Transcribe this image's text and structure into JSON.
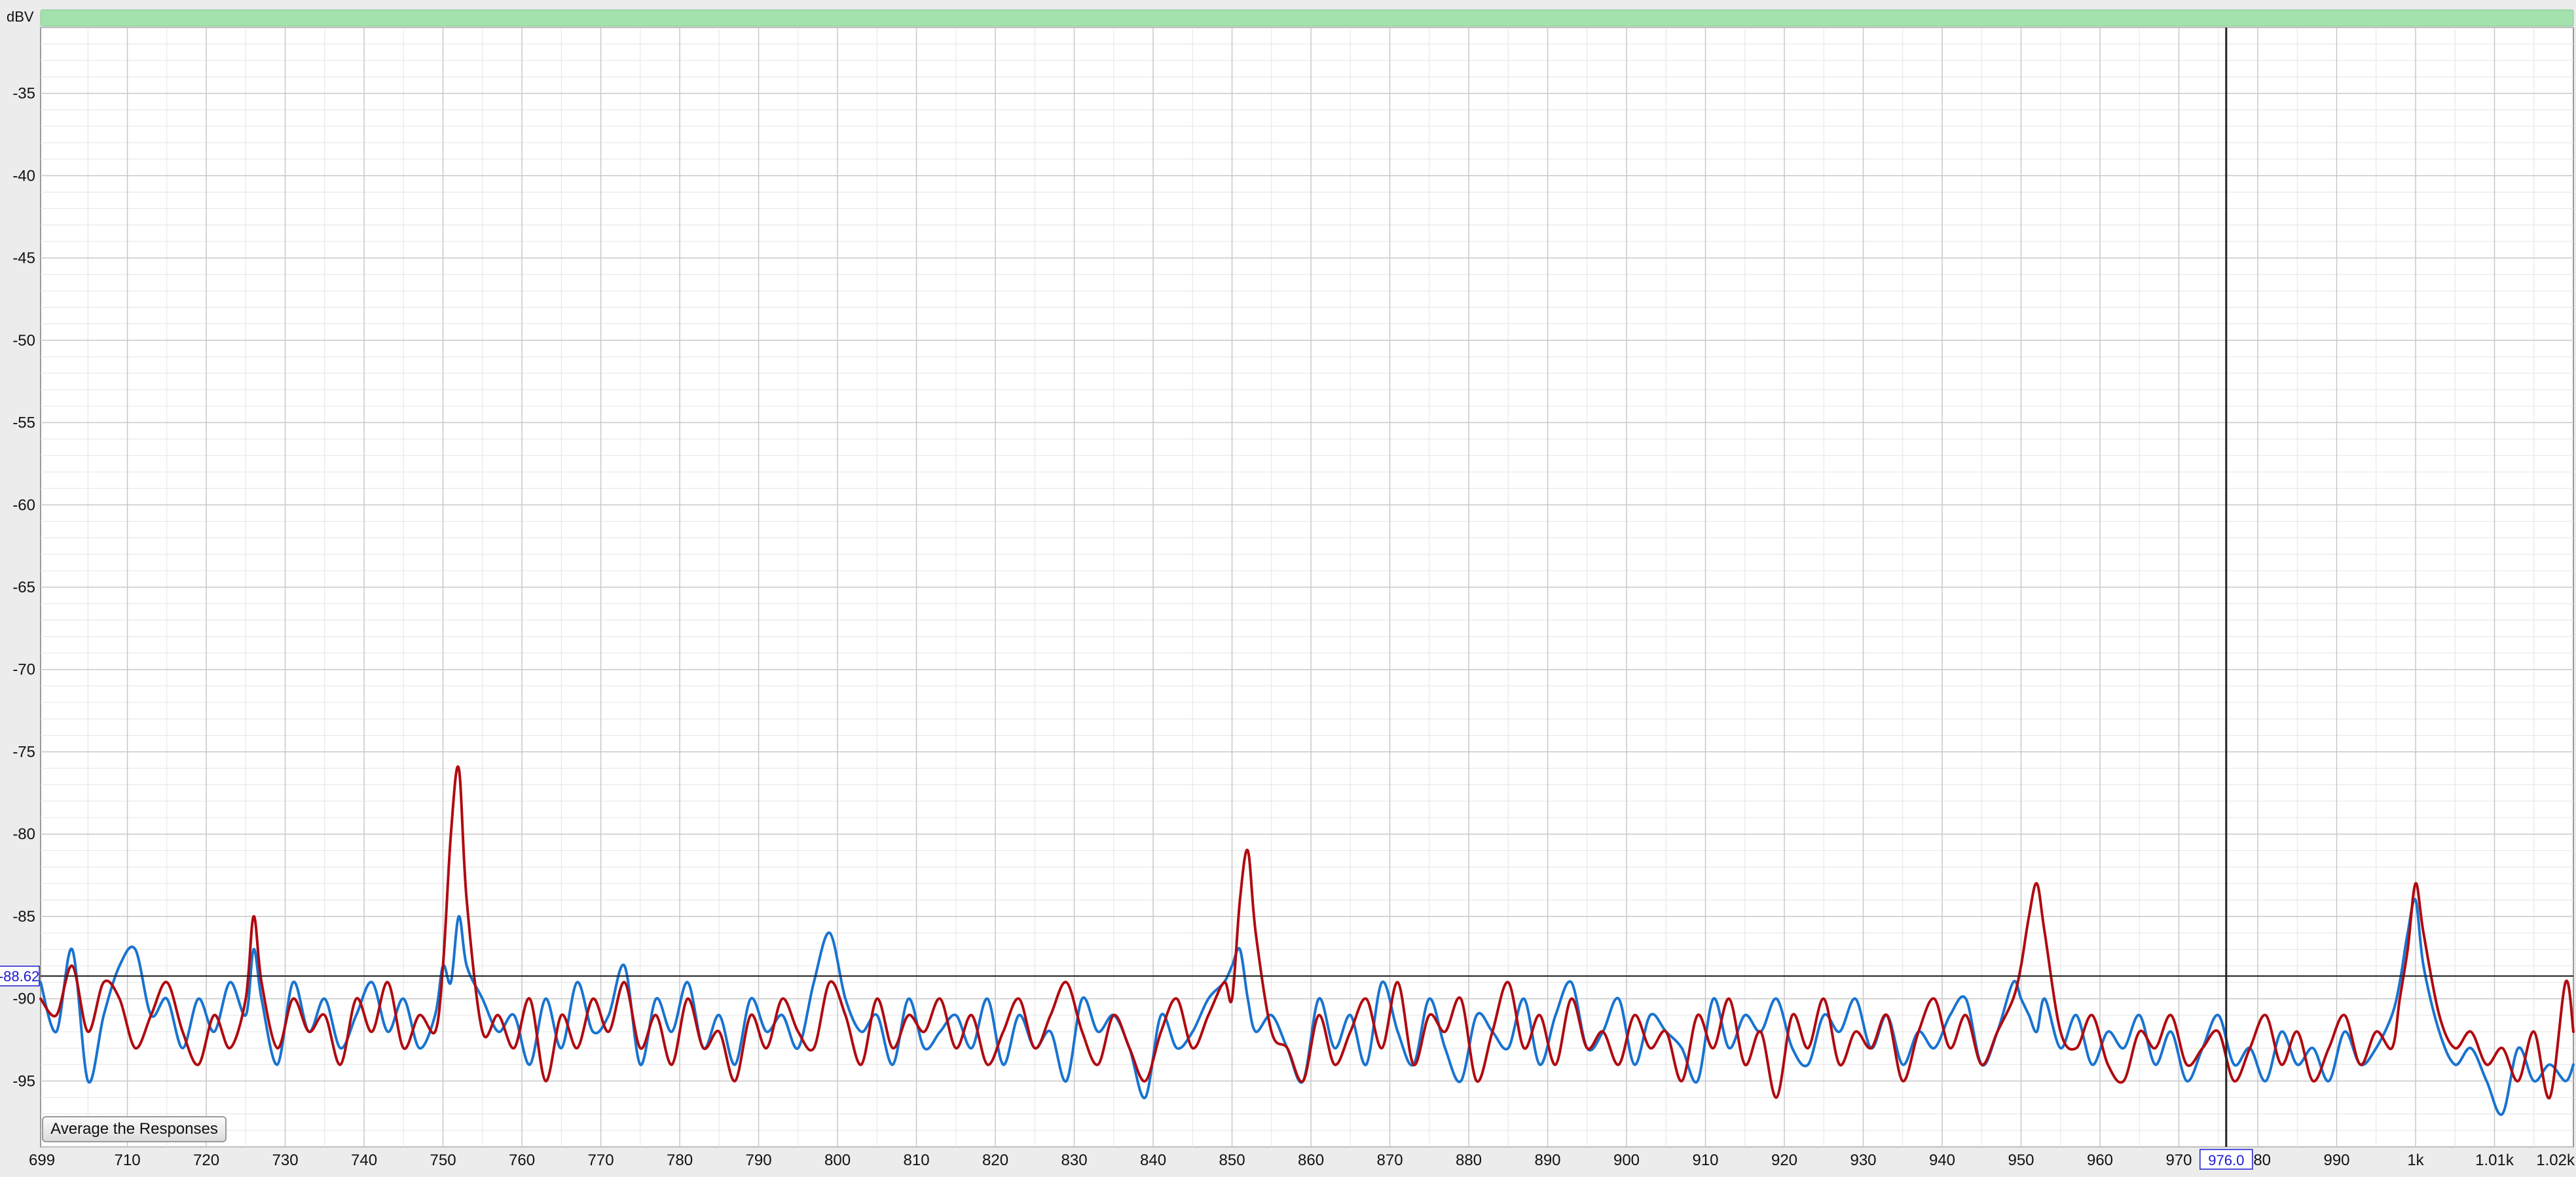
{
  "y_axis_unit": "dBV",
  "cursor_readout": {
    "y_value": "-88.62",
    "x_value": "976.0"
  },
  "button": {
    "average_label": "Average the Responses"
  },
  "colors": {
    "top_bar": "#a3e2ad",
    "plot_bg": "#ffffff",
    "grid_major": "#c8c8c8",
    "grid_minor": "#e4e4e4",
    "series_red": "#b00a0f",
    "series_blue": "#1873d0",
    "readout_text": "#1a1ad0",
    "cursor_line": "#222222"
  },
  "chart_data": {
    "type": "line",
    "xlim": [
      699,
      1020
    ],
    "ylim": [
      -99,
      -31
    ],
    "y_ticks": [
      -35,
      -40,
      -45,
      -50,
      -55,
      -60,
      -65,
      -70,
      -75,
      -80,
      -85,
      -90,
      -95
    ],
    "x_ticks": [
      {
        "v": 699,
        "label": "699"
      },
      {
        "v": 710,
        "label": "710"
      },
      {
        "v": 720,
        "label": "720"
      },
      {
        "v": 730,
        "label": "730"
      },
      {
        "v": 740,
        "label": "740"
      },
      {
        "v": 750,
        "label": "750"
      },
      {
        "v": 760,
        "label": "760"
      },
      {
        "v": 770,
        "label": "770"
      },
      {
        "v": 780,
        "label": "780"
      },
      {
        "v": 790,
        "label": "790"
      },
      {
        "v": 800,
        "label": "800"
      },
      {
        "v": 810,
        "label": "810"
      },
      {
        "v": 820,
        "label": "820"
      },
      {
        "v": 830,
        "label": "830"
      },
      {
        "v": 840,
        "label": "840"
      },
      {
        "v": 850,
        "label": "850"
      },
      {
        "v": 860,
        "label": "860"
      },
      {
        "v": 870,
        "label": "870"
      },
      {
        "v": 880,
        "label": "880"
      },
      {
        "v": 890,
        "label": "890"
      },
      {
        "v": 900,
        "label": "900"
      },
      {
        "v": 910,
        "label": "910"
      },
      {
        "v": 920,
        "label": "920"
      },
      {
        "v": 930,
        "label": "930"
      },
      {
        "v": 940,
        "label": "940"
      },
      {
        "v": 950,
        "label": "950"
      },
      {
        "v": 960,
        "label": "960"
      },
      {
        "v": 970,
        "label": "970"
      },
      {
        "v": 980,
        "label": "980"
      },
      {
        "v": 990,
        "label": "990"
      },
      {
        "v": 1000,
        "label": "1k"
      },
      {
        "v": 1010,
        "label": "1.01k"
      },
      {
        "v": 1020,
        "label": "1.02k"
      }
    ],
    "cursor": {
      "x": 976.0,
      "y": -88.62
    },
    "grid": true,
    "series": [
      {
        "color": "#b00a0f",
        "x": [
          699,
          701,
          703,
          705,
          707,
          709,
          711,
          713,
          715,
          717,
          719,
          721,
          723,
          725,
          726,
          727,
          729,
          731,
          733,
          735,
          737,
          739,
          741,
          743,
          745,
          747,
          749,
          750,
          751,
          752,
          753,
          755,
          757,
          759,
          761,
          763,
          765,
          767,
          769,
          771,
          773,
          775,
          777,
          779,
          781,
          783,
          785,
          787,
          789,
          791,
          793,
          795,
          797,
          799,
          801,
          803,
          805,
          807,
          809,
          811,
          813,
          815,
          817,
          819,
          821,
          823,
          825,
          827,
          829,
          831,
          833,
          835,
          837,
          839,
          841,
          843,
          845,
          847,
          849,
          850,
          851,
          852,
          853,
          855,
          857,
          859,
          861,
          863,
          865,
          867,
          869,
          871,
          873,
          875,
          877,
          879,
          881,
          883,
          885,
          887,
          889,
          891,
          893,
          895,
          897,
          899,
          901,
          903,
          905,
          907,
          909,
          911,
          913,
          915,
          917,
          919,
          921,
          923,
          925,
          927,
          929,
          931,
          933,
          935,
          937,
          939,
          941,
          943,
          945,
          947,
          949,
          950,
          951,
          952,
          953,
          955,
          957,
          959,
          961,
          963,
          965,
          967,
          969,
          971,
          973,
          975,
          977,
          979,
          981,
          983,
          985,
          987,
          989,
          991,
          993,
          995,
          997,
          998,
          999,
          1000,
          1001,
          1003,
          1005,
          1007,
          1009,
          1011,
          1013,
          1015,
          1017,
          1019,
          1020
        ],
        "y": [
          -90,
          -91,
          -88,
          -92,
          -89,
          -90,
          -93,
          -91,
          -89,
          -92,
          -94,
          -91,
          -93,
          -90,
          -85,
          -89,
          -93,
          -90,
          -92,
          -91,
          -94,
          -90,
          -92,
          -89,
          -93,
          -91,
          -92,
          -88,
          -80,
          -76,
          -84,
          -92,
          -91,
          -93,
          -90,
          -95,
          -91,
          -93,
          -90,
          -92,
          -89,
          -93,
          -91,
          -94,
          -90,
          -93,
          -92,
          -95,
          -91,
          -93,
          -90,
          -92,
          -93,
          -89,
          -91,
          -94,
          -90,
          -93,
          -91,
          -92,
          -90,
          -93,
          -91,
          -94,
          -92,
          -90,
          -93,
          -91,
          -89,
          -92,
          -94,
          -91,
          -93,
          -95,
          -92,
          -90,
          -93,
          -91,
          -89,
          -90,
          -84,
          -81,
          -86,
          -92,
          -93,
          -95,
          -91,
          -94,
          -92,
          -90,
          -93,
          -89,
          -94,
          -91,
          -92,
          -90,
          -95,
          -92,
          -89,
          -93,
          -91,
          -94,
          -90,
          -93,
          -92,
          -94,
          -91,
          -93,
          -92,
          -95,
          -91,
          -93,
          -90,
          -94,
          -92,
          -96,
          -91,
          -93,
          -90,
          -94,
          -92,
          -93,
          -91,
          -95,
          -92,
          -90,
          -93,
          -91,
          -94,
          -92,
          -90,
          -88,
          -85,
          -83,
          -86,
          -92,
          -93,
          -91,
          -94,
          -95,
          -92,
          -93,
          -91,
          -94,
          -93,
          -92,
          -95,
          -93,
          -91,
          -94,
          -92,
          -95,
          -93,
          -91,
          -94,
          -92,
          -93,
          -90,
          -87,
          -83,
          -86,
          -91,
          -93,
          -92,
          -94,
          -93,
          -95,
          -92,
          -96,
          -89,
          -92
        ]
      },
      {
        "color": "#1873d0",
        "x": [
          699,
          701,
          703,
          705,
          707,
          709,
          711,
          713,
          715,
          717,
          719,
          721,
          723,
          725,
          726,
          727,
          729,
          731,
          733,
          735,
          737,
          739,
          741,
          743,
          745,
          747,
          749,
          750,
          751,
          752,
          753,
          755,
          757,
          759,
          761,
          763,
          765,
          767,
          769,
          771,
          773,
          775,
          777,
          779,
          781,
          783,
          785,
          787,
          789,
          791,
          793,
          795,
          797,
          799,
          801,
          803,
          805,
          807,
          809,
          811,
          813,
          815,
          817,
          819,
          821,
          823,
          825,
          827,
          829,
          831,
          833,
          835,
          837,
          839,
          841,
          843,
          845,
          847,
          849,
          850,
          851,
          852,
          853,
          855,
          857,
          859,
          861,
          863,
          865,
          867,
          869,
          871,
          873,
          875,
          877,
          879,
          881,
          883,
          885,
          887,
          889,
          891,
          893,
          895,
          897,
          899,
          901,
          903,
          905,
          907,
          909,
          911,
          913,
          915,
          917,
          919,
          921,
          923,
          925,
          927,
          929,
          931,
          933,
          935,
          937,
          939,
          941,
          943,
          945,
          947,
          949,
          950,
          951,
          952,
          953,
          955,
          957,
          959,
          961,
          963,
          965,
          967,
          969,
          971,
          973,
          975,
          977,
          979,
          981,
          983,
          985,
          987,
          989,
          991,
          993,
          995,
          997,
          998,
          999,
          1000,
          1001,
          1003,
          1005,
          1007,
          1009,
          1011,
          1013,
          1015,
          1017,
          1019,
          1020
        ],
        "y": [
          -89,
          -92,
          -87,
          -95,
          -91,
          -88,
          -87,
          -91,
          -90,
          -93,
          -90,
          -92,
          -89,
          -91,
          -87,
          -90,
          -94,
          -89,
          -92,
          -90,
          -93,
          -91,
          -89,
          -92,
          -90,
          -93,
          -91,
          -88,
          -89,
          -85,
          -88,
          -90,
          -92,
          -91,
          -94,
          -90,
          -93,
          -89,
          -92,
          -91,
          -88,
          -94,
          -90,
          -92,
          -89,
          -93,
          -91,
          -94,
          -90,
          -92,
          -91,
          -93,
          -89,
          -86,
          -90,
          -92,
          -91,
          -94,
          -90,
          -93,
          -92,
          -91,
          -93,
          -90,
          -94,
          -91,
          -93,
          -92,
          -95,
          -90,
          -92,
          -91,
          -93,
          -96,
          -91,
          -93,
          -92,
          -90,
          -89,
          -88,
          -87,
          -90,
          -92,
          -91,
          -93,
          -95,
          -90,
          -93,
          -91,
          -94,
          -89,
          -92,
          -94,
          -90,
          -93,
          -95,
          -91,
          -92,
          -93,
          -90,
          -94,
          -91,
          -89,
          -93,
          -92,
          -90,
          -94,
          -91,
          -92,
          -93,
          -95,
          -90,
          -93,
          -91,
          -92,
          -90,
          -93,
          -94,
          -91,
          -92,
          -90,
          -93,
          -91,
          -94,
          -92,
          -93,
          -91,
          -90,
          -94,
          -92,
          -89,
          -90,
          -91,
          -92,
          -90,
          -93,
          -91,
          -94,
          -92,
          -93,
          -91,
          -94,
          -92,
          -95,
          -93,
          -91,
          -94,
          -93,
          -95,
          -92,
          -94,
          -93,
          -95,
          -92,
          -94,
          -93,
          -91,
          -89,
          -86,
          -84,
          -88,
          -92,
          -94,
          -93,
          -95,
          -97,
          -93,
          -95,
          -94,
          -95,
          -94
        ]
      }
    ]
  }
}
